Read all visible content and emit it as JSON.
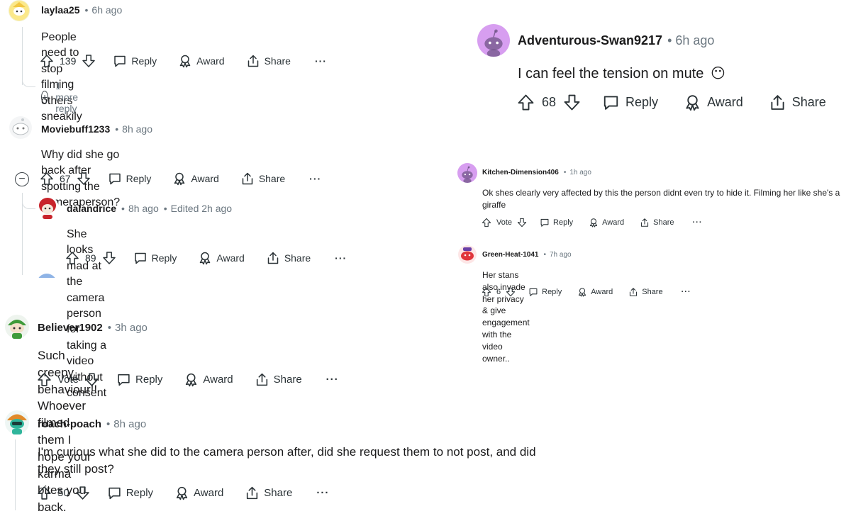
{
  "comments": {
    "c1": {
      "user": "laylaa25",
      "time": "6h ago",
      "text": "People need to stop filming others sneakily",
      "votes": "139",
      "reply": "Reply",
      "award": "Award",
      "share": "Share",
      "more": "1 more reply",
      "avatar_icon": "avatar-snoo-hat-icon"
    },
    "c2": {
      "user": "Moviebuff1233",
      "time": "8h ago",
      "text": "Why did she go back after spotting the cameraperson?",
      "votes": "67",
      "reply": "Reply",
      "award": "Award",
      "share": "Share",
      "avatar_icon": "avatar-snoo-white-icon"
    },
    "c3": {
      "user": "dalandrice",
      "time": "8h ago",
      "edited": "Edited 2h ago",
      "text": "She looks mad at the camera person for taking a video without consent",
      "votes": "89",
      "reply": "Reply",
      "award": "Award",
      "share": "Share",
      "avatar_icon": "avatar-red-hair-icon"
    },
    "c4": {
      "user": "Adventurous-Swan9217",
      "time": "6h ago",
      "text": "I can feel the tension on mute",
      "emoji": "😶",
      "votes": "68",
      "reply": "Reply",
      "award": "Award",
      "share": "Share",
      "avatar_icon": "avatar-snoo-purple-icon"
    },
    "c5": {
      "user": "Kitchen-Dimension406",
      "time": "1h ago",
      "text": "Ok shes clearly very affected by this the person didnt even try to hide it. Filming her like she's a giraffe",
      "votes": "Vote",
      "reply": "Reply",
      "award": "Award",
      "share": "Share",
      "avatar_icon": "avatar-snoo-purple-icon"
    },
    "c6": {
      "user": "Green-Heat-1041",
      "time": "7h ago",
      "text": "Her stans also invade her privacy & give engagement with the video owner..",
      "votes": "6",
      "reply": "Reply",
      "award": "Award",
      "share": "Share",
      "avatar_icon": "avatar-snoo-red-icon"
    },
    "c7": {
      "user": "Believer1902",
      "time": "3h ago",
      "text": "Such creepy behaviour!! Whoever filmed them I hope your karma bites you back.",
      "votes": "Vote",
      "reply": "Reply",
      "award": "Award",
      "share": "Share",
      "avatar_icon": "avatar-green-helmet-icon"
    },
    "c8": {
      "user": "roach-poach",
      "time": "8h ago",
      "text": "I'm curious what she did to the camera person after, did she request them to not post, and did they still post?",
      "votes": "50",
      "reply": "Reply",
      "award": "Award",
      "share": "Share",
      "avatar_icon": "avatar-teal-cap-icon"
    }
  },
  "colors": {
    "text": "#1a1a1b",
    "meta": "#6b7780",
    "icon": "#2a3236",
    "purple_avatar": "#d79ef0"
  }
}
